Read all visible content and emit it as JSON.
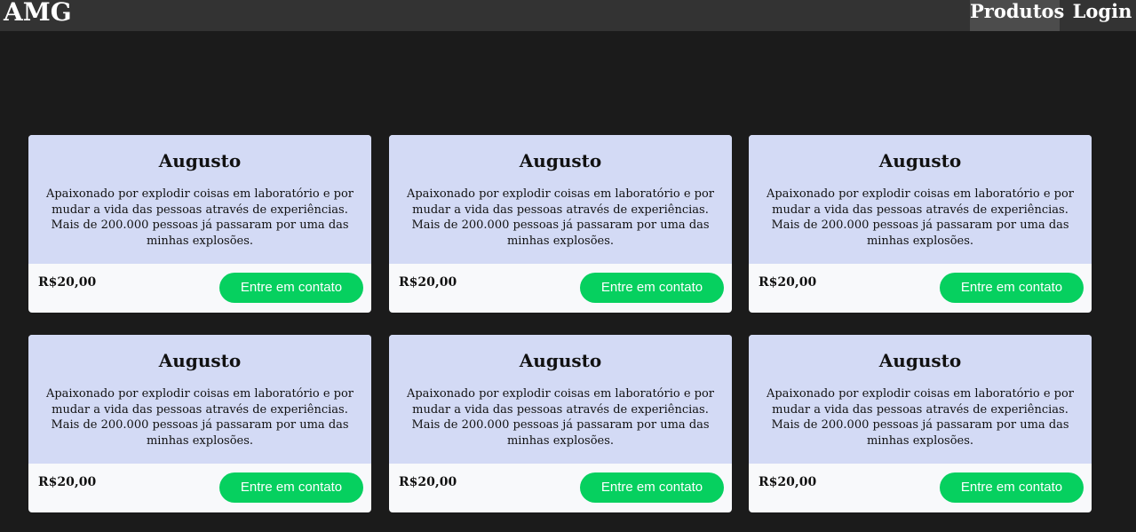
{
  "header": {
    "brand": "AMG",
    "nav": [
      {
        "label": "Produtos",
        "active": true
      },
      {
        "label": "Login",
        "active": false
      }
    ]
  },
  "products": [
    {
      "title": "Augusto",
      "description": "Apaixonado por explodir coisas em laboratório e por mudar a vida das pessoas através de experiências. Mais de 200.000 pessoas já passaram por uma das minhas explosões.",
      "price": "R$20,00",
      "button_label": "Entre em contato"
    },
    {
      "title": "Augusto",
      "description": "Apaixonado por explodir coisas em laboratório e por mudar a vida das pessoas através de experiências. Mais de 200.000 pessoas já passaram por uma das minhas explosões.",
      "price": "R$20,00",
      "button_label": "Entre em contato"
    },
    {
      "title": "Augusto",
      "description": "Apaixonado por explodir coisas em laboratório e por mudar a vida das pessoas através de experiências. Mais de 200.000 pessoas já passaram por uma das minhas explosões.",
      "price": "R$20,00",
      "button_label": "Entre em contato"
    },
    {
      "title": "Augusto",
      "description": "Apaixonado por explodir coisas em laboratório e por mudar a vida das pessoas através de experiências. Mais de 200.000 pessoas já passaram por uma das minhas explosões.",
      "price": "R$20,00",
      "button_label": "Entre em contato"
    },
    {
      "title": "Augusto",
      "description": "Apaixonado por explodir coisas em laboratório e por mudar a vida das pessoas através de experiências. Mais de 200.000 pessoas já passaram por uma das minhas explosões.",
      "price": "R$20,00",
      "button_label": "Entre em contato"
    },
    {
      "title": "Augusto",
      "description": "Apaixonado por explodir coisas em laboratório e por mudar a vida das pessoas através de experiências. Mais de 200.000 pessoas já passaram por uma das minhas explosões.",
      "price": "R$20,00",
      "button_label": "Entre em contato"
    }
  ],
  "colors": {
    "page_background": "#1b1b1b",
    "header_background": "#333333",
    "active_nav_background": "#4c4c4c",
    "card_body": "#d3daf5",
    "card_footer": "#f8f9fb",
    "button": "#06d05f"
  }
}
